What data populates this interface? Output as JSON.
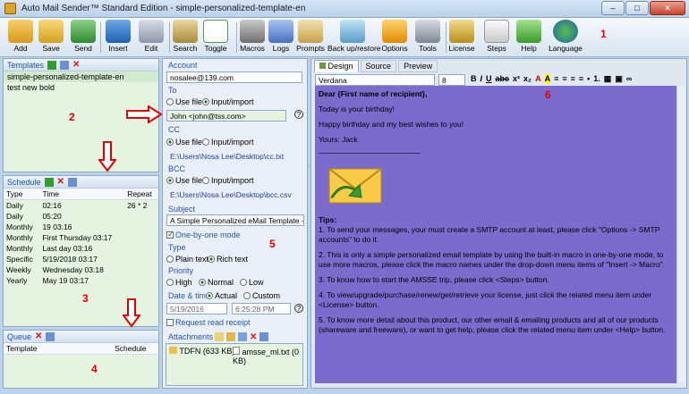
{
  "window": {
    "title": "Auto Mail Sender™ Standard Edition - simple-personalized-template-en"
  },
  "toolbar": [
    {
      "name": "add",
      "label": "Add"
    },
    {
      "name": "save",
      "label": "Save"
    },
    {
      "name": "send",
      "label": "Send"
    },
    {
      "name": "insert",
      "label": "Insert"
    },
    {
      "name": "edit",
      "label": "Edit"
    },
    {
      "name": "search",
      "label": "Search"
    },
    {
      "name": "toggle",
      "label": "Toggle"
    },
    {
      "name": "macros",
      "label": "Macros"
    },
    {
      "name": "logs",
      "label": "Logs"
    },
    {
      "name": "prompts",
      "label": "Prompts"
    },
    {
      "name": "backup",
      "label": "Back up/restore"
    },
    {
      "name": "options",
      "label": "Options"
    },
    {
      "name": "tools",
      "label": "Tools"
    },
    {
      "name": "license",
      "label": "License"
    },
    {
      "name": "steps",
      "label": "Steps"
    },
    {
      "name": "help",
      "label": "Help"
    },
    {
      "name": "language",
      "label": "Language"
    }
  ],
  "markers": [
    "1",
    "2",
    "3",
    "4",
    "5",
    "6"
  ],
  "templates": {
    "title": "Templates",
    "items": [
      "simple-personalized-template-en",
      "test new bold"
    ]
  },
  "schedule": {
    "title": "Schedule",
    "columns": [
      "Type",
      "Time",
      "Repeat"
    ],
    "rows": [
      [
        "Daily",
        "02:16",
        "26 * 2"
      ],
      [
        "Daily",
        "05:20",
        ""
      ],
      [
        "Monthly",
        "19 03:16",
        ""
      ],
      [
        "Monthly",
        "First Thursday 03:17",
        ""
      ],
      [
        "Monthly",
        "Last day 03:16",
        ""
      ],
      [
        "Specific",
        "5/19/2018 03:17",
        ""
      ],
      [
        "Weekly",
        "Wednesday 03:18",
        ""
      ],
      [
        "Yearly",
        "May 19 03:17",
        ""
      ]
    ]
  },
  "queue": {
    "title": "Queue",
    "columns": [
      "Template",
      "Schedule"
    ]
  },
  "compose": {
    "account_label": "Account",
    "account_value": "nosalee@139.com",
    "to_label": "To",
    "use_file": "Use file",
    "input_import": "Input/import",
    "to_value": "John <john@tss.com>",
    "cc_label": "CC",
    "cc_path": "E:\\Users\\Nosa Lee\\Desktop\\cc.txt",
    "bcc_label": "BCC",
    "bcc_path": "E:\\Users\\Nosa Lee\\Desktop\\bcc.csv",
    "subject_label": "Subject",
    "subject_value": "A Simple Personalized eMail Template - Happy",
    "one_by_one": "One-by-one mode",
    "type_label": "Type",
    "plain": "Plain text",
    "rich": "Rich text",
    "priority_label": "Priority",
    "high": "High",
    "normal": "Normal",
    "low": "Low",
    "datetime_label": "Date & time",
    "actual": "Actual",
    "custom": "Custom",
    "date_value": "5/19/2016",
    "time_value": "6:25:28 PM",
    "request_receipt": "Request read receipt",
    "attachments_label": "Attachments",
    "attachments": [
      "TDFN (633 KB)",
      "amsse_ml.txt (0 KB)"
    ]
  },
  "editor": {
    "tabs": [
      "Design",
      "Source",
      "Preview"
    ],
    "font": "Verdana",
    "size": "8",
    "greeting": "Dear {First name of recipient},",
    "line1": "Today is your birthday!",
    "line2": "Happy birthday and my best wishes to you!",
    "line3": "Yours: Jack",
    "rule": "________________________",
    "tips_title": "Tips:",
    "tips": [
      "1. To send your messages, your must create a SMTP account at least, please click \"Options -> SMTP accounts\" to do it.",
      "2. This is only a simple personalized email template by using the built-in macro in one-by-one mode, to use more macros, please click the macro names under the drop-down menu items of \"Insert -> Macro\".",
      "3. To know how to start the AMSSE trip, please click <Steps> button.",
      "4. To view/upgrade/purchase/renew/get/retrieve your license, just click the related menu item under <License> button.",
      "5. To know more detail about this product, our other email & emailing products and all of our products (shareware and freeware), or want to get help, please click the related menu item under <Help> button."
    ]
  },
  "colors": {
    "accent": "#1a56a8",
    "editor_bg": "#7a6bcd",
    "marker": "#e00000",
    "field_bg": "#e4f4e1"
  }
}
